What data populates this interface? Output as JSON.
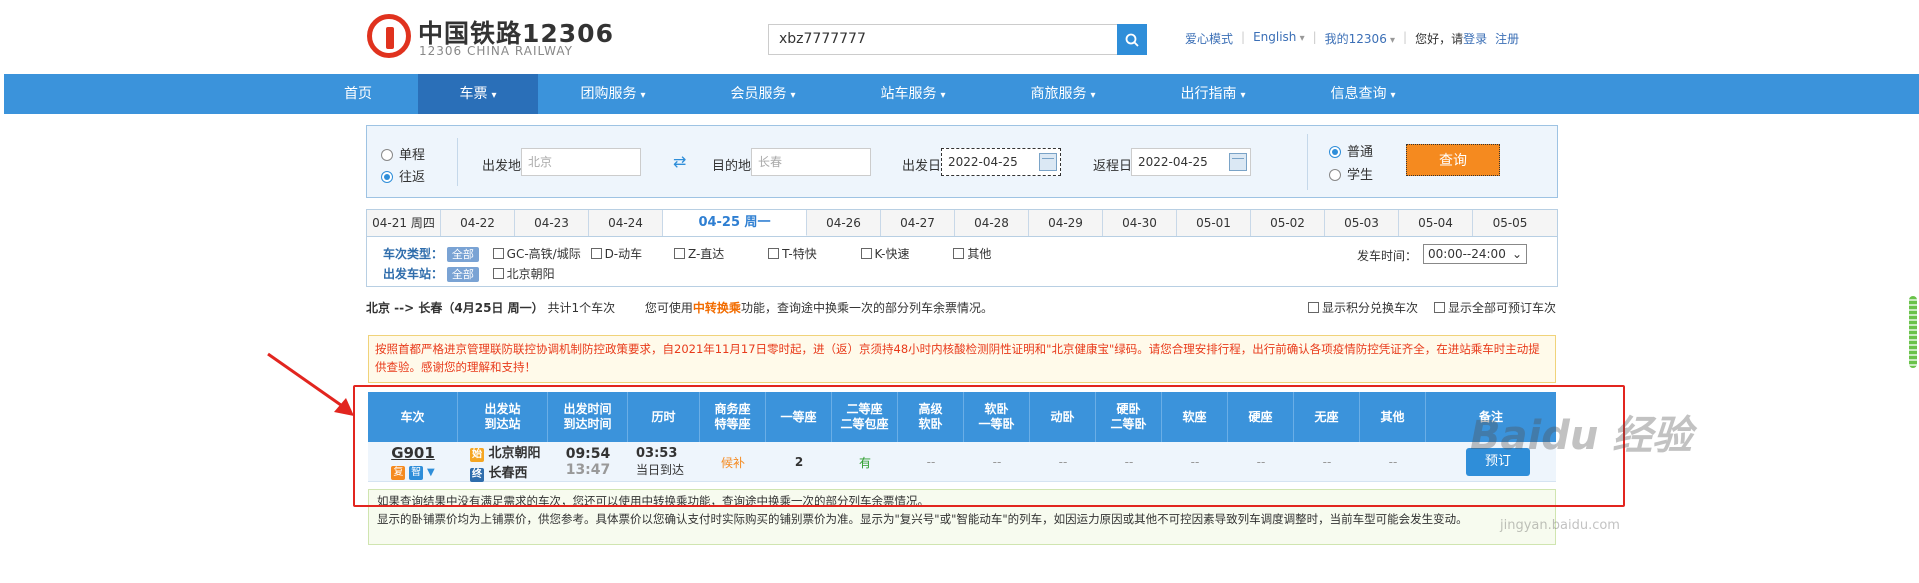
{
  "header": {
    "logo_title": "中国铁路12306",
    "logo_subtitle": "12306 CHINA RAILWAY",
    "search_value": "xbz7777777",
    "links": {
      "care_mode": "爱心模式",
      "english": "English",
      "my12306": "我的12306",
      "greeting": "您好，请",
      "login": "登录",
      "register": "注册"
    }
  },
  "nav": {
    "items": [
      "首页",
      "车票",
      "团购服务",
      "会员服务",
      "站车服务",
      "商旅服务",
      "出行指南",
      "信息查询"
    ]
  },
  "query": {
    "one_way": "单程",
    "round_trip": "往返",
    "from_label": "出发地",
    "from_value": "北京",
    "to_label": "目的地",
    "to_value": "长春",
    "depart_label": "出发日",
    "depart_value": "2022-04-25",
    "return_label": "返程日",
    "return_value": "2022-04-25",
    "normal": "普通",
    "student": "学生",
    "search_button": "查询"
  },
  "date_tabs": [
    "04-21 周四",
    "04-22",
    "04-23",
    "04-24",
    "04-25 周一",
    "04-26",
    "04-27",
    "04-28",
    "04-29",
    "04-30",
    "05-01",
    "05-02",
    "05-03",
    "05-04",
    "05-05"
  ],
  "filters": {
    "type_label": "车次类型：",
    "station_label": "出发车站：",
    "all": "全部",
    "types": [
      "GC-高铁/城际",
      "D-动车",
      "Z-直达",
      "T-特快",
      "K-快速",
      "其他"
    ],
    "station": "北京朝阳",
    "time_label": "发车时间：",
    "time_value": "00:00--24:00"
  },
  "result": {
    "route": "北京 --> 长春（4月25日  周一）",
    "count": "共计1个车次",
    "tip_pre": "您可使用",
    "tip_link": "中转换乘",
    "tip_post": "功能，查询途中换乘一次的部分列车余票情况。",
    "opt1": "显示积分兑换车次",
    "opt2": "显示全部可预订车次"
  },
  "notice": "按照首都严格进京管理联防联控协调机制防控政策要求，自2021年11月17日零时起，进（返）京须持48小时内核酸检测阴性证明和\"北京健康宝\"绿码。请您合理安排行程，出行前确认各项疫情防控凭证齐全，在进站乘车时主动提供查验。感谢您的理解和支持！",
  "table": {
    "headers": [
      "车次",
      "出发站\n到达站",
      "出发时间\n到达时间",
      "历时",
      "商务座\n特等座",
      "一等座",
      "二等座\n二等包座",
      "高级\n软卧",
      "软卧\n一等卧",
      "动卧",
      "硬卧\n二等卧",
      "软座",
      "硬座",
      "无座",
      "其他",
      "备注"
    ],
    "row": {
      "train": "G901",
      "tag1": "复",
      "tag2": "智",
      "from_tag": "始",
      "to_tag": "终",
      "from_station": "北京朝阳",
      "to_station": "长春西",
      "depart_time": "09:54",
      "arrive_time": "13:47",
      "duration": "03:53",
      "arrive_day": "当日到达",
      "business": "候补",
      "first": "2",
      "second": "有",
      "dash": "--",
      "book": "预订"
    }
  },
  "footer": {
    "line1": "如果查询结果中没有满足需求的车次，您还可以使用中转换乘功能，查询途中换乘一次的部分列车余票情况。",
    "line2": "显示的卧铺票价均为上铺票价，供您参考。具体票价以您确认支付时实际购买的铺别票价为准。显示为\"复兴号\"或\"智能动车\"的列车，如因运力原因或其他不可控因素导致列车调度调整时，当前车型可能会发生变动。"
  },
  "watermark": "Baidu 经验",
  "watermark_url": "jingyan.baidu.com",
  "colors": {
    "nav": "#3b93db",
    "nav_active": "#2a6fb8",
    "accent": "#f58a1f",
    "annotation": "#e2251f"
  }
}
